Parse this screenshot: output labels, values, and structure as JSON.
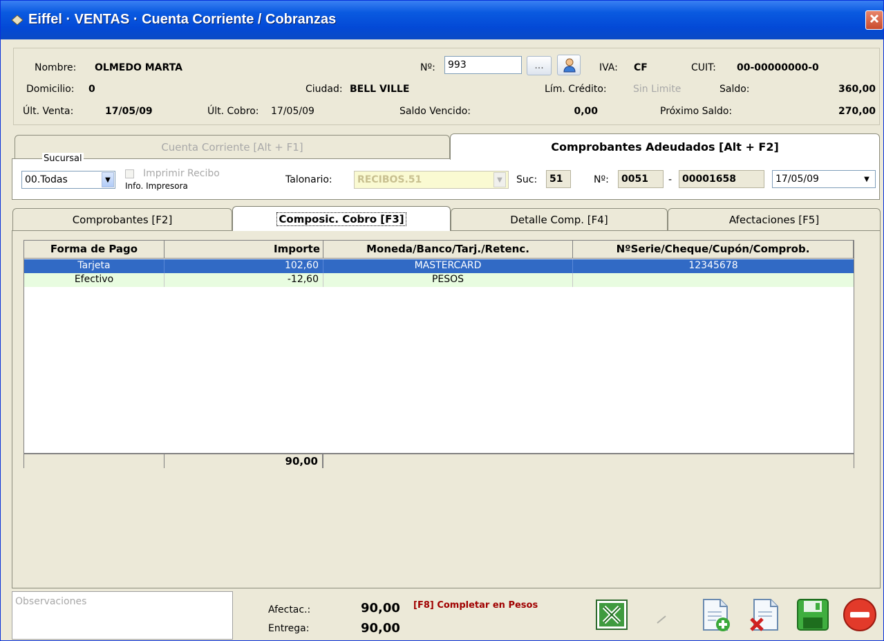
{
  "window": {
    "title": "Eiffel · VENTAS · Cuenta Corriente / Cobranzas"
  },
  "client": {
    "nombre_label": "Nombre:",
    "nombre_value": "OLMEDO MARTA",
    "numero_label": "Nº:",
    "numero_value": "993",
    "ellipsis_label": "...",
    "iva_label": "IVA:",
    "iva_value": "CF",
    "cuit_label": "CUIT:",
    "cuit_value": "00-00000000-0",
    "domicilio_label": "Domicilio:",
    "domicilio_value": "0",
    "ciudad_label": "Ciudad:",
    "ciudad_value": "BELL VILLE",
    "limcred_label": "Lím. Crédito:",
    "limcred_value": "Sin Limite",
    "saldo_label": "Saldo:",
    "saldo_value": "360,00",
    "ultventa_label": "Últ. Venta:",
    "ultventa_value": "17/05/09",
    "ultcobro_label": "Últ. Cobro:",
    "ultcobro_value": "17/05/09",
    "saldovencido_label": "Saldo Vencido:",
    "saldovencido_value": "0,00",
    "proxsaldo_label": "Próximo Saldo:",
    "proxsaldo_value": "270,00"
  },
  "top_tabs": {
    "cuenta": "Cuenta Corriente [Alt + F1]",
    "adeudados": "Comprobantes Adeudados [Alt + F2]"
  },
  "receipt": {
    "sucursal_label": "Sucursal",
    "sucursal_value": "00.Todas",
    "imprimir_label": "Imprimir Recibo",
    "info_label": "Info. Impresora",
    "talonario_label": "Talonario:",
    "talonario_value": "RECIBOS.51",
    "suc_label": "Suc:",
    "suc_value": "51",
    "nro_label": "Nº:",
    "nro_prefix": "0051",
    "nro_dash": "-",
    "nro_value": "00001658",
    "fecha_value": "17/05/09"
  },
  "tabs": {
    "comprobantes": "Comprobantes [F2]",
    "composic": "Composic. Cobro [F3]",
    "detalle": "Detalle Comp. [F4]",
    "afectaciones": "Afectaciones [F5]"
  },
  "grid": {
    "headers": [
      "Forma de Pago",
      "Importe",
      "Moneda/Banco/Tarj./Retenc.",
      "NºSerie/Cheque/Cupón/Comprob."
    ],
    "rows": [
      [
        "Tarjeta",
        "102,60",
        "MASTERCARD",
        "12345678"
      ],
      [
        "Efectivo",
        "-12,60",
        "PESOS",
        ""
      ]
    ],
    "total": "90,00"
  },
  "footer": {
    "observaciones_placeholder": "Observaciones",
    "afectac_label": "Afectac.:",
    "afectac_value": "90,00",
    "entrega_label": "Entrega:",
    "entrega_value": "90,00",
    "completar_label": "[F8] Completar en Pesos"
  },
  "colors": {
    "selection": "#316ac5",
    "row_alt": "#e8fce0",
    "accent_red": "#a00000",
    "titlebar": "#0349d6"
  },
  "icons": [
    "diamond-icon",
    "close-icon",
    "user-icon",
    "excel-icon",
    "pen-icon",
    "new-doc-icon",
    "delete-doc-icon",
    "save-icon",
    "cancel-icon"
  ]
}
